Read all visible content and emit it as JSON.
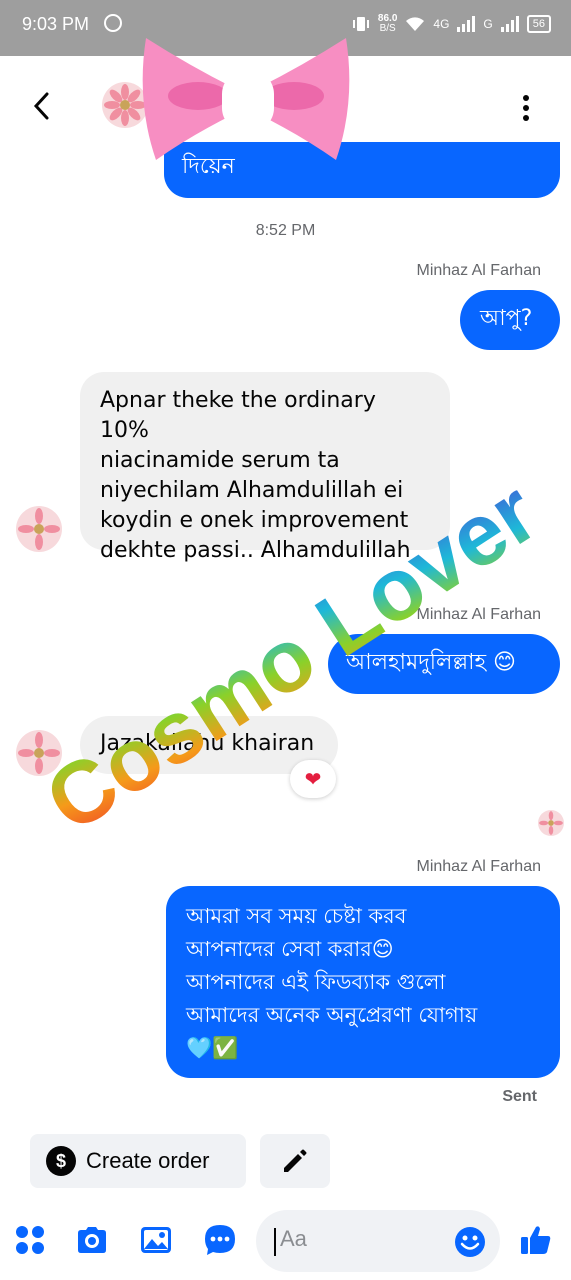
{
  "status_bar": {
    "time": "9:03 PM",
    "net_speed_value": "86.0",
    "net_speed_unit": "B/S",
    "network_4g": "4G",
    "network_g": "G",
    "battery": "56"
  },
  "header": {
    "back_icon": "chevron-left-icon",
    "more_icon": "more-vertical-icon"
  },
  "messages": {
    "partial_top_text": "দিয়েন",
    "timestamp": "8:52 PM",
    "sender_1": "Minhaz Al Farhan",
    "msg_1": "আপু?",
    "msg_2_lines": [
      "Apnar theke the ordinary 10%",
      "niacinamide serum ta",
      "niyechilam Alhamdulillah ei",
      "koydin e onek  improvement",
      "dekhte passi.. Alhamdulillah"
    ],
    "sender_2": "Minhaz Al Farhan",
    "msg_3": "আলহামদুলিল্লাহ 😊",
    "msg_4": "Jazakallahu khairan",
    "msg_4_reaction": "❤",
    "sender_3": "Minhaz Al Farhan",
    "msg_5_lines": [
      "আমরা সব সময় চেষ্টা করব",
      "আপনাদের সেবা করার😊",
      "আপনাদের এই ফিডব্যাক গুলো",
      "আমাদের অনেক অনুপ্রেরণা যোগায়",
      "🩵✅"
    ],
    "status": "Sent"
  },
  "quick_actions": {
    "create_order": "Create order",
    "create_order_icon": "dollar-icon",
    "edit_icon": "pencil-icon"
  },
  "composer": {
    "placeholder": "Aa",
    "icons": [
      "apps-icon",
      "camera-icon",
      "gallery-icon",
      "chat-bubble-icon",
      "emoji-icon",
      "thumbs-up-icon"
    ]
  },
  "watermark": {
    "text": "Cosmo Lover"
  },
  "colors": {
    "outgoing_bubble": "#0866ff",
    "incoming_bubble": "#f0f0f0",
    "accent": "#0866ff",
    "status_bar": "#9e9e9e"
  }
}
